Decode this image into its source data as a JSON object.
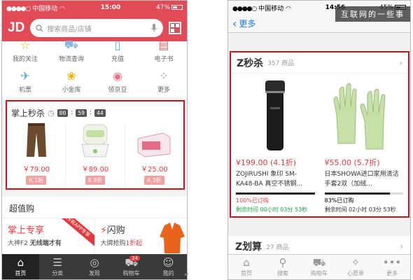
{
  "left": {
    "status": {
      "signal": "●●●●○",
      "carrier": "中国移动",
      "time": "15:00",
      "battery": "47%"
    },
    "header": {
      "logo": "JD",
      "search_placeholder": "搜索商品/店铺"
    },
    "shortcuts": [
      {
        "label": "我的关注",
        "icon": "star-icon",
        "glyph": "☆",
        "color": "#f0b400"
      },
      {
        "label": "物流查询",
        "icon": "truck-icon",
        "glyph": "⛟",
        "color": "#8bb8e0"
      },
      {
        "label": "充值",
        "icon": "phone-icon",
        "glyph": "▯",
        "color": "#5ab8e6"
      },
      {
        "label": "电子书",
        "icon": "book-icon",
        "glyph": "▤",
        "color": "#e56b6b"
      },
      {
        "label": "机票",
        "icon": "plane-icon",
        "glyph": "✈",
        "color": "#5aa9e6"
      },
      {
        "label": "小金库",
        "icon": "piggy-bank-icon",
        "glyph": "❀",
        "color": "#f0b400"
      },
      {
        "label": "领京豆",
        "icon": "bean-icon",
        "glyph": "◉",
        "color": "#e5728a"
      },
      {
        "label": "更多",
        "icon": "grid-icon",
        "glyph": "⁘",
        "color": "#999999"
      }
    ],
    "flash_sale": {
      "title": "掌上秒杀",
      "timer": [
        "00",
        "59",
        "44"
      ],
      "items": [
        {
          "price": "￥79.00",
          "discount": "6.1折",
          "image": "trousers"
        },
        {
          "price": "￥89.00",
          "discount": "8.9折",
          "image": "humidifier"
        },
        {
          "price": "￥25.00",
          "discount": "4.3折",
          "image": "box"
        }
      ]
    },
    "section": {
      "title": "超值购",
      "promo_left": {
        "title": "掌上专享",
        "subtitle_a": "大神F2",
        "subtitle_b": "无线端才有",
        "ribbon": "所有APP专享"
      },
      "promo_right": {
        "title": "闪购",
        "subtitle_a": "大牌抢购",
        "subtitle_b": "1折起"
      }
    },
    "tabs": [
      {
        "label": "首页",
        "icon": "home-icon",
        "glyph": "⌂"
      },
      {
        "label": "分类",
        "icon": "category-icon",
        "glyph": "☰"
      },
      {
        "label": "发现",
        "icon": "discover-icon",
        "glyph": "◎"
      },
      {
        "label": "购物车",
        "icon": "cart-icon",
        "glyph": "⛟",
        "badge": "24"
      },
      {
        "label": "我的",
        "icon": "user-icon",
        "glyph": "☺"
      }
    ]
  },
  "right": {
    "status": {
      "signal": "●●●●○",
      "carrier": "中国移动",
      "time": "14:56",
      "battery": "45%"
    },
    "watermark": "互联网的一些事",
    "nav": {
      "back_label": "更多"
    },
    "flash": {
      "title": "Z秒杀",
      "count": "357 商品",
      "items": [
        {
          "price": "¥199.00",
          "discount": "(4.1折)",
          "name": "ZOJIRUSHI 象印 SM-KA48-BA 真空不锈钢...",
          "sold_text": "100%已订购",
          "sold_fraction": 1.0,
          "remain": "剩余时间 00小时 03分 53秒",
          "image": "thermos"
        },
        {
          "price": "¥55.00",
          "discount": "(5.7折)",
          "name": "日本SHOWA进口家用清洁手套2双（加绒...",
          "sold_text": "83%已订购",
          "sold_fraction": 0.83,
          "remain": "剩余时间 02小时 03分 53秒",
          "image": "gloves"
        }
      ]
    },
    "sub_section": {
      "title": "Z划算",
      "count": "27 商品"
    },
    "tabs": [
      {
        "label": "首页",
        "icon": "home-icon",
        "glyph": "⌂"
      },
      {
        "label": "搜索",
        "icon": "search-icon",
        "glyph": "⚲"
      },
      {
        "label": "购物车",
        "icon": "cart-icon",
        "glyph": "⛟"
      },
      {
        "label": "心愿单",
        "icon": "wishlist-icon",
        "glyph": "✧"
      },
      {
        "label": "更多",
        "icon": "more-icon",
        "glyph": "•••"
      }
    ]
  },
  "colors": {
    "jd_red": "#e24a55",
    "price_red": "#e4393c",
    "highlight_border": "#c4161c",
    "ios_blue": "#1a7cf0",
    "timer_green": "#1aa24b"
  }
}
